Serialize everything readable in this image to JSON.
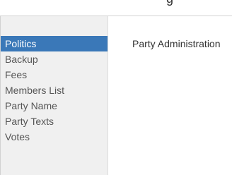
{
  "header": {
    "partial_title": "g"
  },
  "sidebar": {
    "items": [
      {
        "label": "Politics",
        "active": true
      },
      {
        "label": "Backup"
      },
      {
        "label": "Fees"
      },
      {
        "label": "Members List"
      },
      {
        "label": "Party Name"
      },
      {
        "label": "Party Texts"
      },
      {
        "label": "Votes"
      }
    ]
  },
  "main": {
    "title": "Party Administration"
  },
  "colors": {
    "active_bg": "#3a78b8",
    "sidebar_bg": "#f0f0f0",
    "text": "#333333"
  }
}
